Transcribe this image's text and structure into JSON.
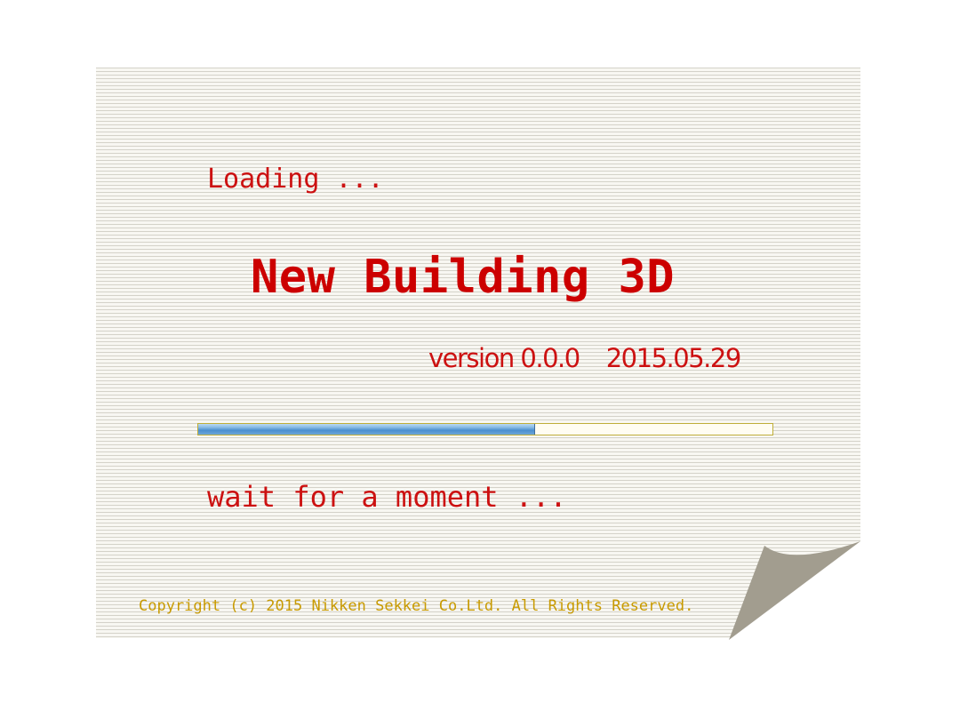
{
  "splash": {
    "loading_label": "Loading ...",
    "app_title": "New Building 3D",
    "version": "version 0.0.0",
    "date": "2015.05.29",
    "progress_fraction": 0.587,
    "wait_label": "wait for a moment ...",
    "copyright": "Copyright (c) 2015 Nikken Sekkei Co.Ltd. All Rights Reserved."
  },
  "colors": {
    "text_red": "#cc1111",
    "title_red": "#cc0000",
    "copyright_gold": "#c89a00",
    "progress_blue": "#4a8fcf",
    "page_curl": "#a29d8f"
  },
  "icons": {
    "corner": "page-curl-icon"
  }
}
